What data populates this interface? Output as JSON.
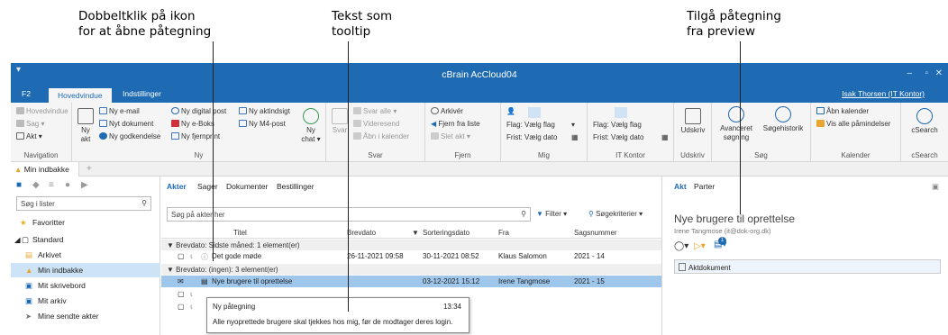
{
  "annotations": {
    "left": [
      "Dobbeltklik på ikon",
      "for at åbne påtegning"
    ],
    "middle": [
      "Tekst som",
      "tooltip"
    ],
    "right": [
      "Tilgå påtegning",
      "fra preview"
    ]
  },
  "window": {
    "title": "cBrain AcCloud04",
    "user": "Isak Thorsen (IT Kontor)",
    "ribbon_tabs": [
      "F2",
      "Hovedvindue",
      "Indstillinger"
    ]
  },
  "ribbon": {
    "navigation": {
      "items": [
        "Hovedvindue",
        "Sag",
        "Akt"
      ],
      "label": "Navigation"
    },
    "ny": {
      "big": [
        "Ny",
        "akt"
      ],
      "items": [
        "Ny e-mail",
        "Nyt dokument",
        "Ny godkendelse",
        "Ny digital post",
        "Ny e-Boks",
        "Ny fjernprint",
        "Ny aktindsigt",
        "Ny M4-post"
      ],
      "chat": [
        "Ny",
        "chat"
      ],
      "label": "Ny"
    },
    "svar": {
      "items": [
        "Svar alle",
        "Videresend",
        "Åbn i kalender"
      ],
      "big": "Svar",
      "label": "Svar"
    },
    "fjern": {
      "items": [
        "Arkivér",
        "Fjern fra liste",
        "Slet akt"
      ],
      "label": "Fjern"
    },
    "mig": {
      "flag": "Flag:",
      "flag_val": "Vælg flag",
      "frist": "Frist:",
      "frist_val": "Vælg dato",
      "label": "Mig"
    },
    "itkontor": {
      "flag": "Flag:",
      "flag_val": "Vælg flag",
      "frist": "Frist:",
      "frist_val": "Vælg dato",
      "label": "IT Kontor"
    },
    "udskriv": {
      "big": "Udskriv",
      "label": "Udskriv"
    },
    "sog": {
      "advanced": [
        "Avanceret",
        "søgning"
      ],
      "history": "Søgehistorik",
      "label": "Søg"
    },
    "kalender": {
      "items": [
        "Åbn kalender",
        "Vis alle påmindelser"
      ],
      "label": "Kalender"
    },
    "csearch": {
      "big": "cSearch",
      "label": "cSearch"
    }
  },
  "doc_tab": {
    "label": "Min indbakke"
  },
  "left_pane": {
    "search_placeholder": "Søg i lister",
    "items": [
      "Favoritter",
      "Standard",
      "Arkivet",
      "Min indbakke",
      "Mit skrivebord",
      "Mit arkiv",
      "Mine sendte akter"
    ]
  },
  "middle_pane": {
    "tabs": [
      "Akter",
      "Sager",
      "Dokumenter",
      "Bestillinger"
    ],
    "search_placeholder": "Søg på akter her",
    "filter": "Filter",
    "criteria": "Søgekriterier",
    "columns": [
      "Titel",
      "Brevdato",
      "Sorteringsdato",
      "Fra",
      "Sagsnummer"
    ],
    "groups": [
      {
        "label": "Brevdato: Sidste måned: 1 element(er)"
      },
      {
        "label": "Brevdato: (ingen): 3 element(er)"
      }
    ],
    "rows": [
      {
        "title": "Det gode møde",
        "brevdato": "26-11-2021 09:58",
        "sorteringsdato": "30-11-2021 08:52",
        "fra": "Klaus Salomon",
        "sagsnummer": "2021 - 14"
      },
      {
        "title": "Nye brugere til oprettelse",
        "brevdato": "",
        "sorteringsdato": "03-12-2021 15:12",
        "fra": "Irene Tangmose",
        "sagsnummer": "2021 - 15"
      }
    ],
    "tooltip": {
      "title": "Ny påtegning",
      "time": "13:34",
      "text": "Alle nyoprettede brugere skal tjekkes hos mig, før de modtager deres login."
    }
  },
  "right_pane": {
    "tabs": [
      "Akt",
      "Parter"
    ],
    "title": "Nye brugere til oprettelse",
    "from": "Irene Tangmose (it@dok-org.dk)",
    "badge": "1",
    "doc_label": "Aktdokument"
  }
}
